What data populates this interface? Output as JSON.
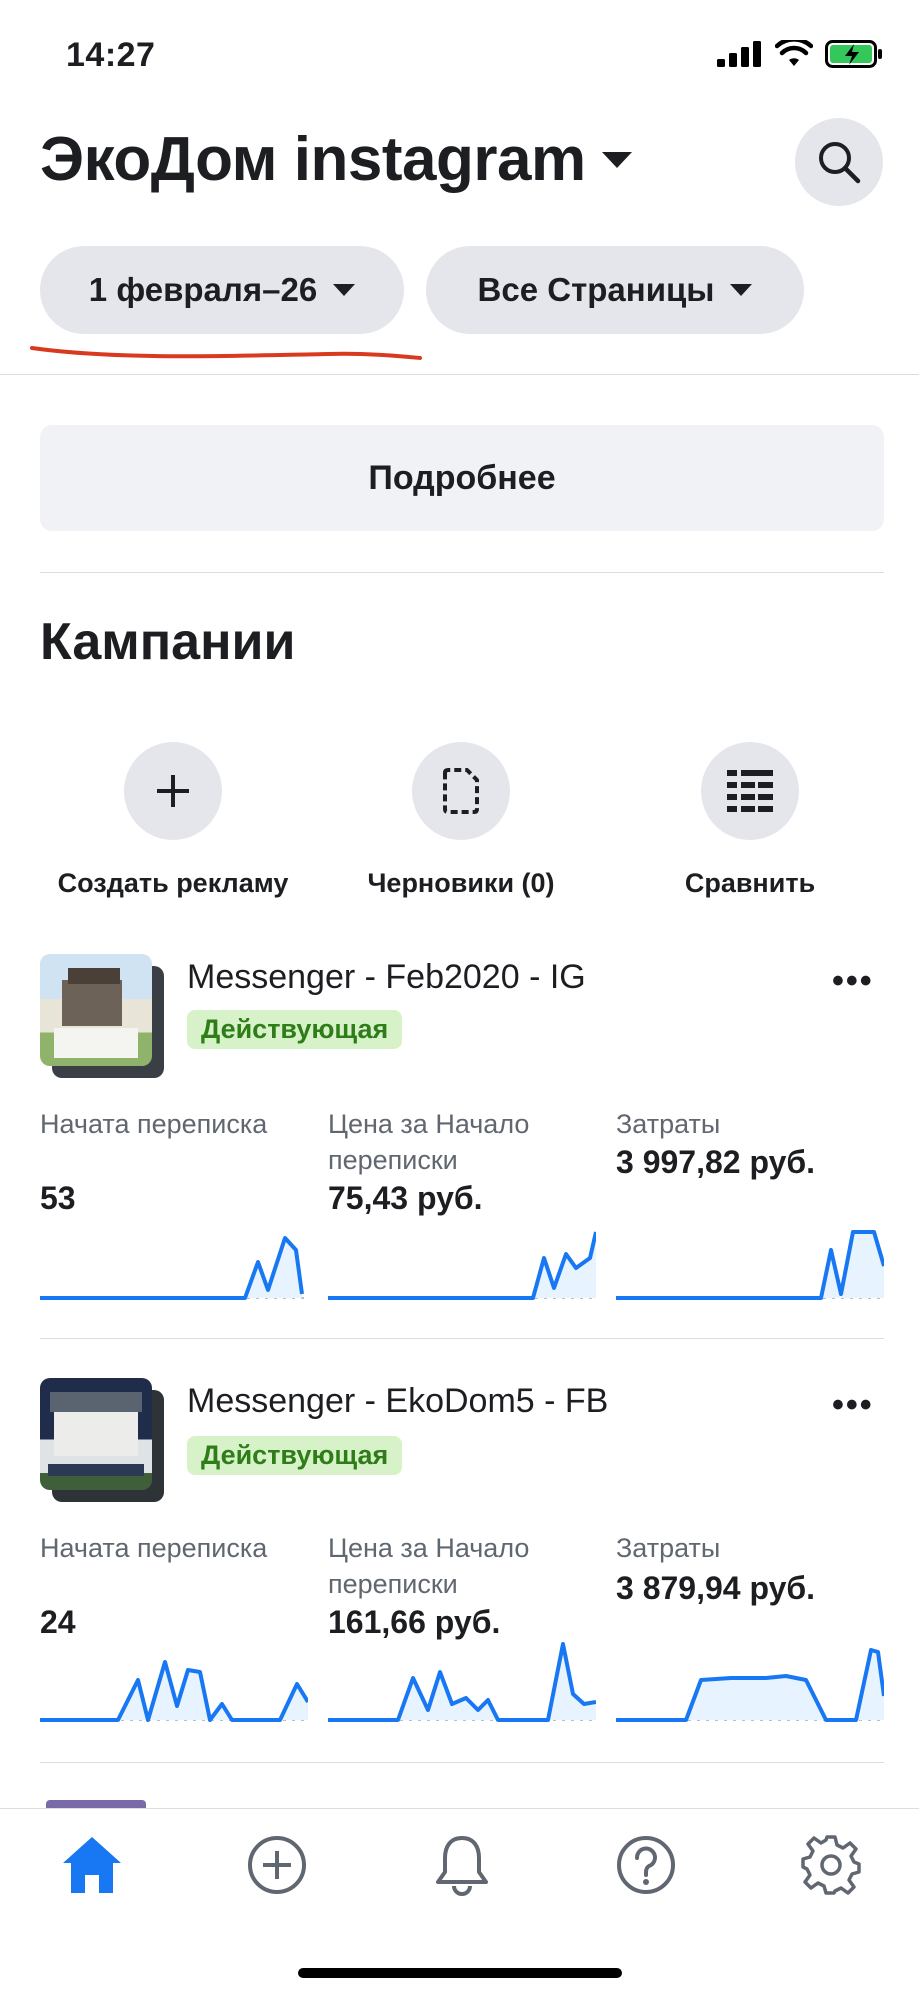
{
  "status_bar": {
    "time": "14:27"
  },
  "header": {
    "title": "ЭкоДом instagram"
  },
  "filters": {
    "date_range": "1 февраля–26",
    "pages": "Все Страницы"
  },
  "more_button": "Подробнее",
  "campaigns_section": {
    "title": "Кампании",
    "actions": [
      {
        "label": "Создать рекламу",
        "icon": "plus-icon"
      },
      {
        "label": "Черновики (0)",
        "icon": "document-icon"
      },
      {
        "label": "Сравнить",
        "icon": "list-icon"
      }
    ]
  },
  "campaigns": [
    {
      "name": "Messenger - Feb2020 - IG",
      "status": "Действующая",
      "metrics": [
        {
          "label": "Начата переписка",
          "value": "53"
        },
        {
          "label": "Цена за Начало переписки",
          "value": "75,43 руб."
        },
        {
          "label": "Затраты",
          "value": "3 997,82 руб."
        }
      ]
    },
    {
      "name": "Messenger - EkoDom5 - FB",
      "status": "Действующая",
      "metrics": [
        {
          "label": "Начата переписка",
          "value": "24"
        },
        {
          "label": "Цена за Начало переписки",
          "value": "161,66 руб."
        },
        {
          "label": "Затраты",
          "value": "3 879,94 руб."
        }
      ]
    }
  ],
  "tab_bar": {
    "items": [
      "home-icon",
      "plus-circle-icon",
      "bell-icon",
      "help-icon",
      "settings-icon"
    ],
    "active": "home-icon"
  },
  "colors": {
    "accent": "#1877f2",
    "status_bg": "#d7f2c9",
    "status_text": "#2f7d19",
    "annotation": "#d93a1f"
  }
}
